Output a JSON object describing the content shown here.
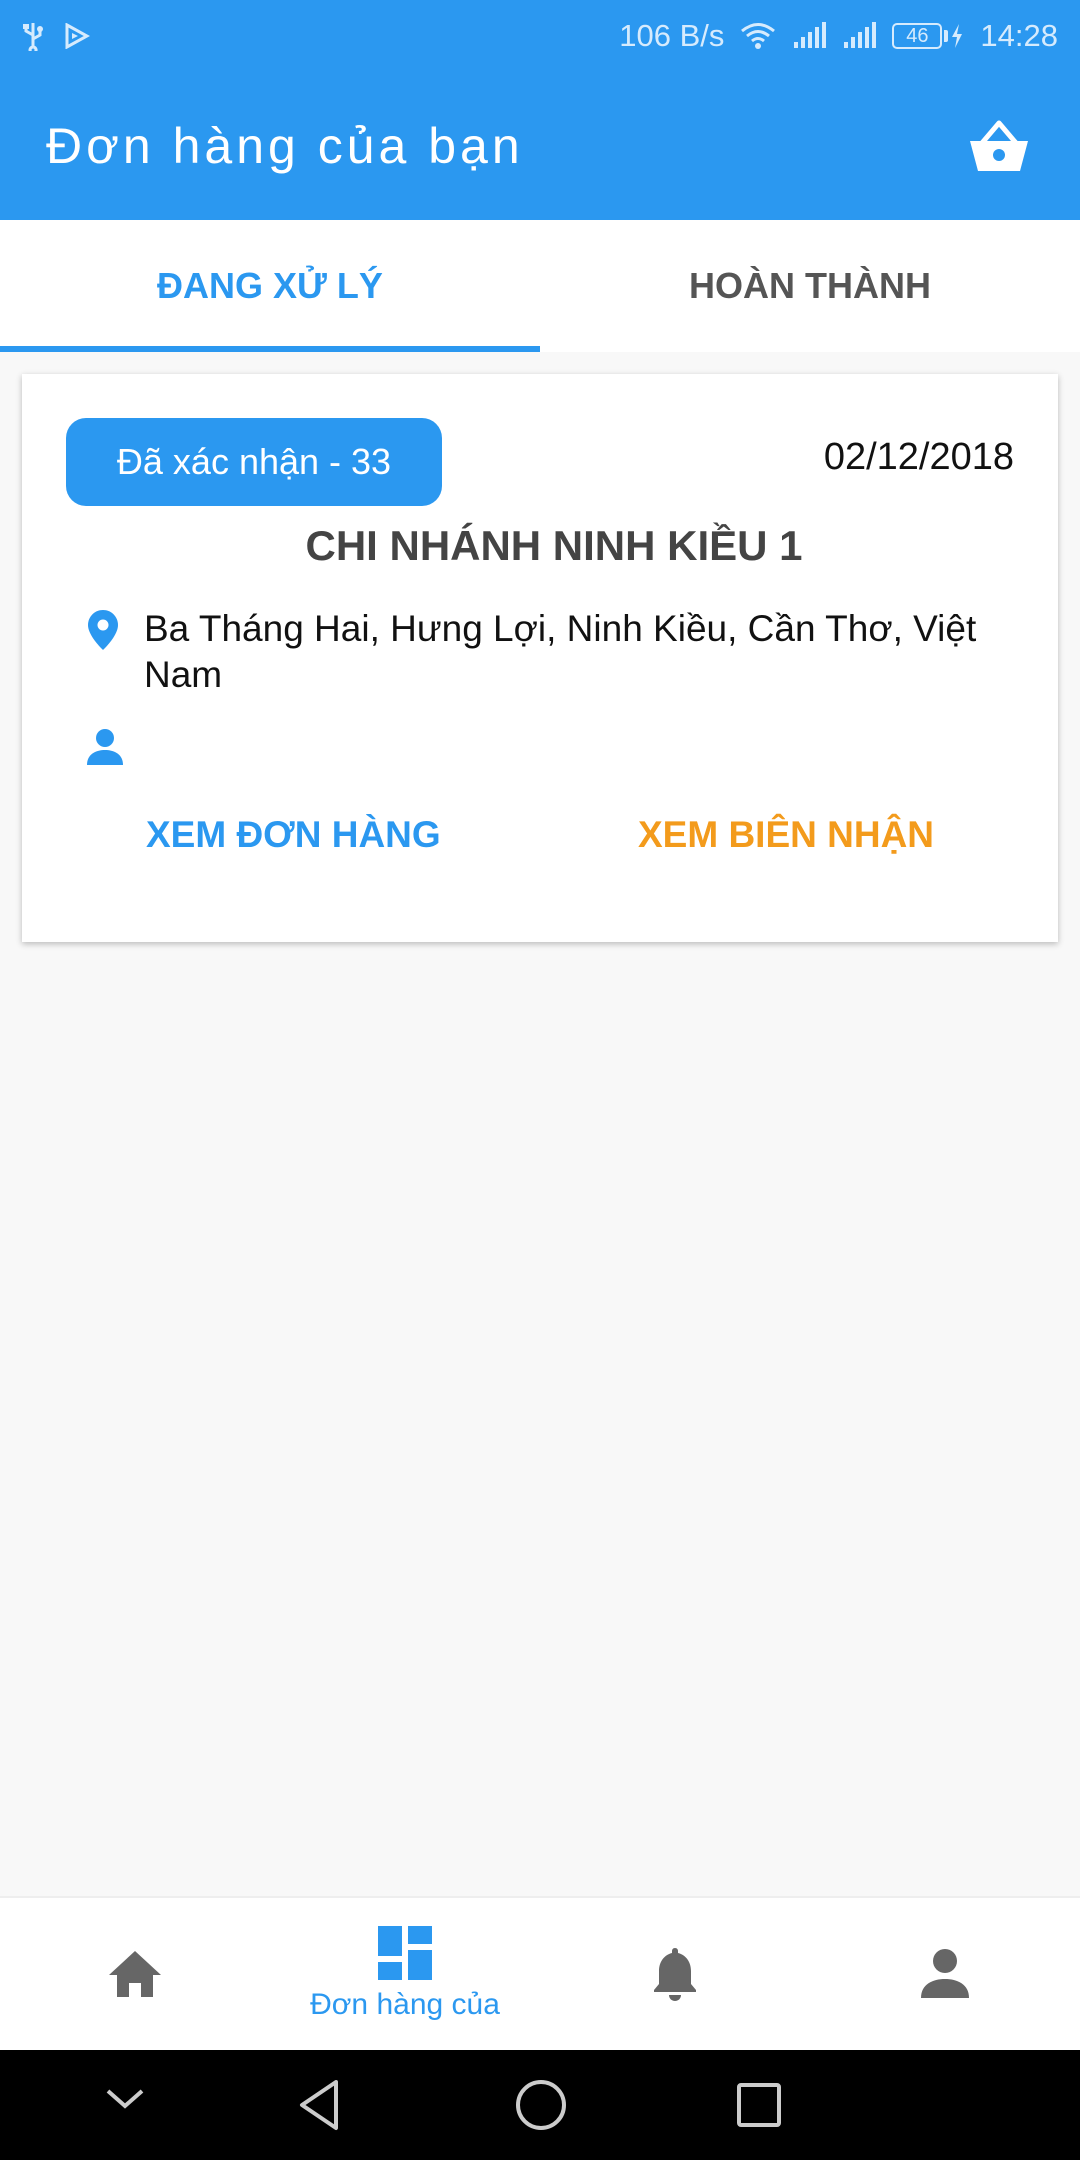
{
  "status_bar": {
    "network_speed": "106 B/s",
    "battery_level": "46",
    "time": "14:28"
  },
  "app_bar": {
    "title": "Đơn hàng của bạn"
  },
  "tabs": [
    {
      "label": "ĐANG XỬ LÝ",
      "active": true
    },
    {
      "label": "HOÀN THÀNH",
      "active": false
    }
  ],
  "order": {
    "status_badge": "Đã xác nhận - 33",
    "date": "02/12/2018",
    "branch_name": "CHI NHÁNH NINH KIỀU 1",
    "address": "Ba Tháng Hai, Hưng Lợi, Ninh Kiều, Cần Thơ, Việt Nam",
    "customer_name": "",
    "view_order_label": "XEM ĐƠN HÀNG",
    "view_receipt_label": "XEM BIÊN NHẬN"
  },
  "bottom_nav": [
    {
      "icon": "home-icon",
      "label": ""
    },
    {
      "icon": "dashboard-icon",
      "label": "Đơn hàng của",
      "active": true
    },
    {
      "icon": "bell-icon",
      "label": ""
    },
    {
      "icon": "person-icon",
      "label": ""
    }
  ],
  "colors": {
    "primary": "#2b98f0",
    "accent_orange": "#f39b1c",
    "background": "#f8f8f8"
  }
}
